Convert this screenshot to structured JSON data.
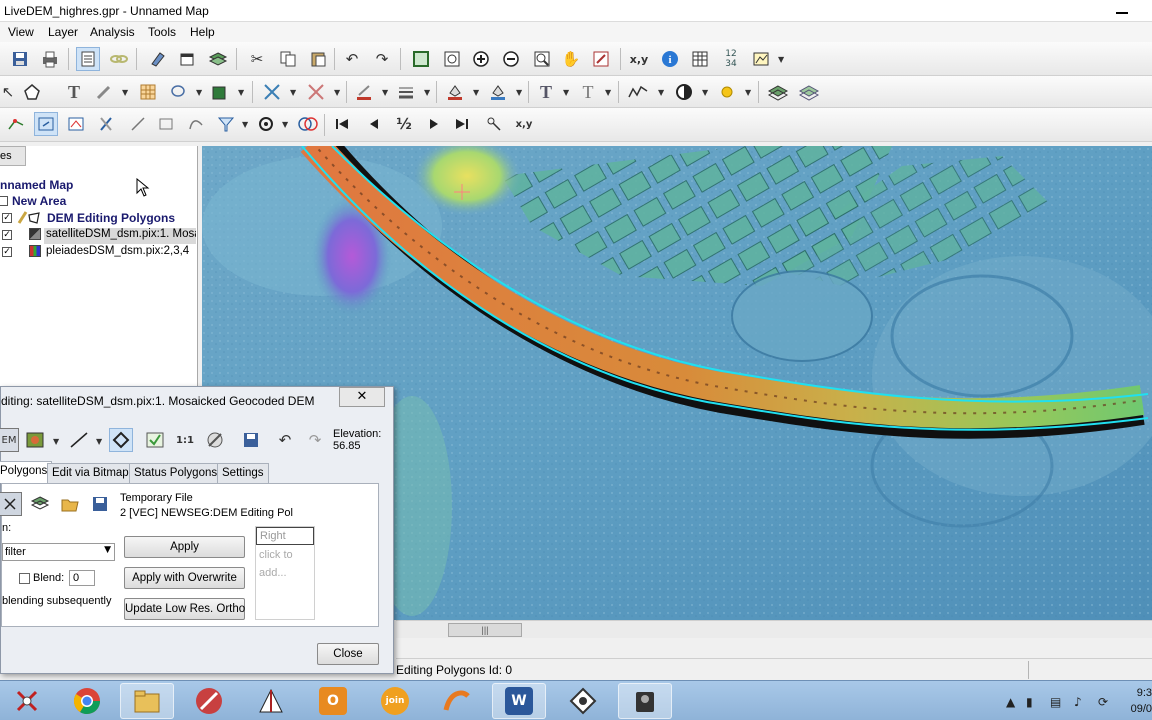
{
  "window": {
    "title": "LiveDEM_highres.gpr - Unnamed Map"
  },
  "menu": [
    "View",
    "Layer",
    "Analysis",
    "Tools",
    "Help"
  ],
  "toolbar3": {
    "fraction_label": "½",
    "xy_label": "x,y"
  },
  "layers_panel": {
    "tab_label": "es",
    "tree": {
      "map": "nnamed Map",
      "area": "New Area",
      "group": "DEM Editing Polygons",
      "layers": [
        "satelliteDSM_dsm.pix:1. Mosaic",
        "pleiadesDSM_dsm.pix:2,3,4"
      ]
    }
  },
  "map_view": {
    "scrollbar_thumb": "|||"
  },
  "status_bar": {
    "text": "Editing Polygons  Id: 0"
  },
  "dialog": {
    "title": "diting: satelliteDSM_dsm.pix:1. Mosaicked Geocoded DEM",
    "close_x": "✕",
    "toolbar_label": "EM",
    "elevation_label": "Elevation:",
    "elevation_value": "56.85",
    "tabs": [
      "Polygons",
      "Edit via Bitmap",
      "Status Polygons",
      "Settings"
    ],
    "active_tab": 0,
    "file_line1": "Temporary File",
    "file_line2": "2 [VEC] NEWSEG:DEM Editing Pol",
    "n_label": "n:",
    "filter_value": "filter",
    "blend_label": "Blend:",
    "blend_value": "0",
    "blending_text": "blending subsequently",
    "apply_button": "Apply",
    "apply_overwrite_button": "Apply with Overwrite",
    "update_button": "Update Low Res. Ortho",
    "right_placeholder": "Right",
    "right_hint_1": "click to",
    "right_hint_2": "add...",
    "close_button": "Close"
  },
  "taskbar": {
    "apps": [
      "snipping-tool",
      "chrome",
      "file-explorer",
      "media-app",
      "geomatica-focus",
      "outlook",
      "join-me",
      "geomatica-app",
      "word",
      "network-app",
      "camera-app"
    ],
    "active_index": 2,
    "clock_time": "9:3",
    "clock_date": "09/0"
  }
}
